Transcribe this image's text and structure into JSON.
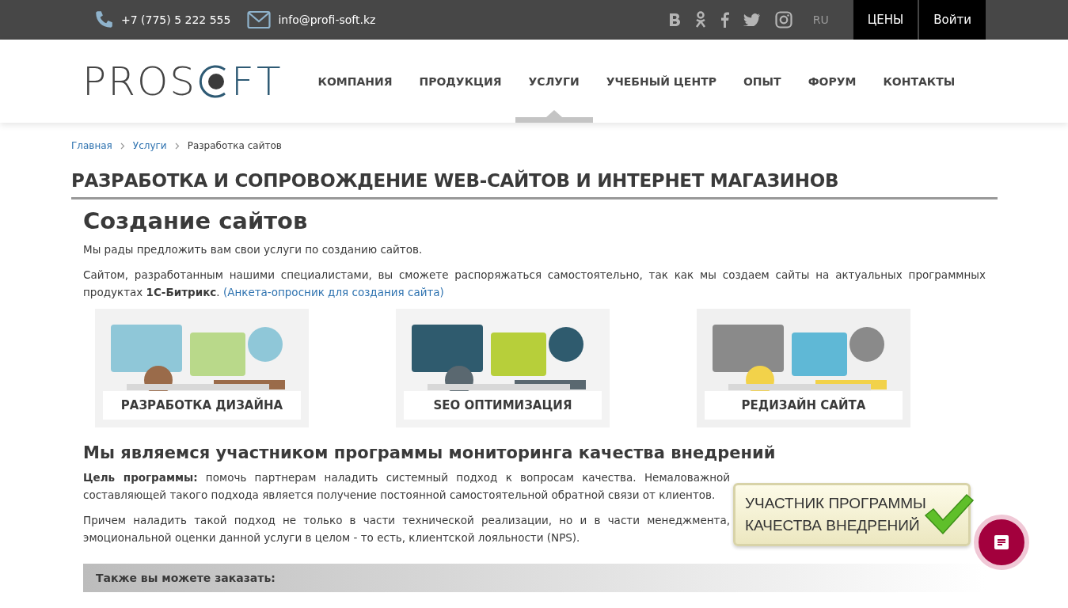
{
  "topbar": {
    "phone": "+7 (775) 5 222 555",
    "email": "info@profi-soft.kz",
    "language": {
      "label": "RU",
      "selected": false
    },
    "buttons": [
      {
        "label": "ЦЕНЫ"
      },
      {
        "label": "Войти"
      }
    ]
  },
  "logo": {
    "left": "PROS",
    "right": "FT"
  },
  "nav": [
    {
      "label": "КОМПАНИЯ",
      "selected": false
    },
    {
      "label": "ПРОДУКЦИЯ",
      "selected": false
    },
    {
      "label": "УСЛУГИ",
      "selected": true
    },
    {
      "label": "УЧЕБНЫЙ ЦЕНТР",
      "selected": false
    },
    {
      "label": "ОПЫТ",
      "selected": false
    },
    {
      "label": "ФОРУМ",
      "selected": false
    },
    {
      "label": "КОНТАКТЫ",
      "selected": false
    }
  ],
  "breadcrumbs": [
    {
      "label": "Главная",
      "link": true
    },
    {
      "label": "Услуги",
      "link": true
    },
    {
      "label": "Разработка сайтов",
      "link": false
    }
  ],
  "page_title": "РАЗРАБОТКА И СОПРОВОЖДЕНИЕ WEB-САЙТОВ И ИНТЕРНЕТ МАГАЗИНОВ",
  "section_title": "Создание сайтов",
  "intro": "Мы рады предложить вам свои услуги по созданию сайтов.",
  "body": "Сайтом, разработанным нашими специалистами, вы сможете распоряжаться самостоятельно, так как мы создаем сайты на актуальных программных продуктах **1С-Битрикс**.",
  "body_link": "(Анкета-опросник для создания сайта)",
  "cards": [
    {
      "caption": "РАЗРАБОТКА ДИЗАЙНА",
      "kind": "design"
    },
    {
      "caption": "SEO ОПТИМИЗАЦИЯ",
      "kind": "seo"
    },
    {
      "caption": "РЕДИЗАЙН САЙТА",
      "kind": "redesign"
    }
  ],
  "program_title": "Мы являемся участником программы мониторинга качества внедрений",
  "badge": {
    "line1": "УЧАСТНИК ПРОГРАММЫ",
    "line2": "КАЧЕСТВА ВНЕДРЕНИЙ"
  },
  "paragraphs": [
    "**Цель программы:** помочь партнерам наладить системный подход к вопросам качества. Немаловажной составляющей такого подхода является получение постоянной самостоятельной обратной связи от клиентов.",
    "Причем наладить такой подход не только в части технической реализации, но и в части менеджмента, эмоциональной оценки данной услуги в целом - то есть, клиентской лояльности (NPS)."
  ],
  "also_order": "Также вы можете заказать:"
}
